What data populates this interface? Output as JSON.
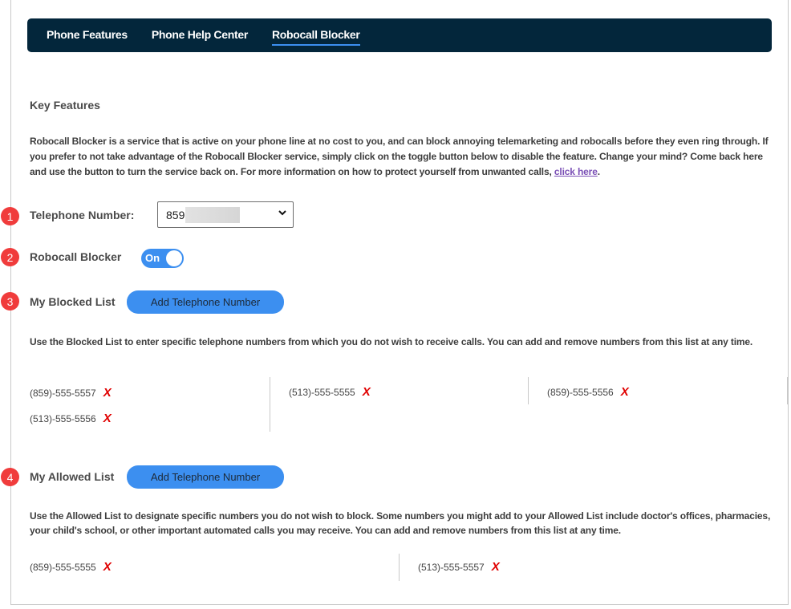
{
  "nav": {
    "items": [
      {
        "label": "Phone Features",
        "active": false
      },
      {
        "label": "Phone Help Center",
        "active": false
      },
      {
        "label": "Robocall Blocker",
        "active": true
      }
    ]
  },
  "key_features": {
    "title": "Key Features",
    "intro": "Robocall Blocker is a service that is active on your phone line at no cost to you, and can block annoying telemarketing and robocalls before they even ring through. If you prefer to not take advantage of the Robocall Blocker service, simply click on the toggle button below to disable the feature. Change your mind? Come back here and use the button to turn the service back on. For more information on how to protect yourself from unwanted calls, ",
    "link_text": "click here",
    "intro_end": "."
  },
  "steps": [
    "1",
    "2",
    "3",
    "4"
  ],
  "telephone": {
    "label": "Telephone Number:",
    "selected_value": "859"
  },
  "robocall": {
    "label": "Robocall Blocker",
    "toggle_label": "On",
    "enabled": true
  },
  "blocked_list": {
    "label": "My Blocked List",
    "add_button": "Add Telephone Number",
    "description": "Use the Blocked List to enter specific telephone numbers from which you do not wish to receive calls. You can add and remove numbers from this list at any time.",
    "numbers": [
      "(859)-555-5557",
      "(513)-555-5555",
      "(859)-555-5556",
      "(513)-555-5556"
    ]
  },
  "allowed_list": {
    "label": "My Allowed List",
    "add_button": "Add Telephone Number",
    "description": "Use the Allowed List to designate specific numbers you do not wish to block. Some numbers you might add to your Allowed List include doctor's offices, pharmacies, your child's school, or other important automated calls you may receive. You can add and remove numbers from this list at any time.",
    "numbers": [
      "(859)-555-5555",
      "(513)-555-5557"
    ]
  },
  "delete_glyph": "X",
  "colors": {
    "nav_bg": "#03263b",
    "accent": "#3c8ff0",
    "badge": "#f03c3c",
    "delete": "#e00000",
    "link": "#7a4fb5"
  }
}
